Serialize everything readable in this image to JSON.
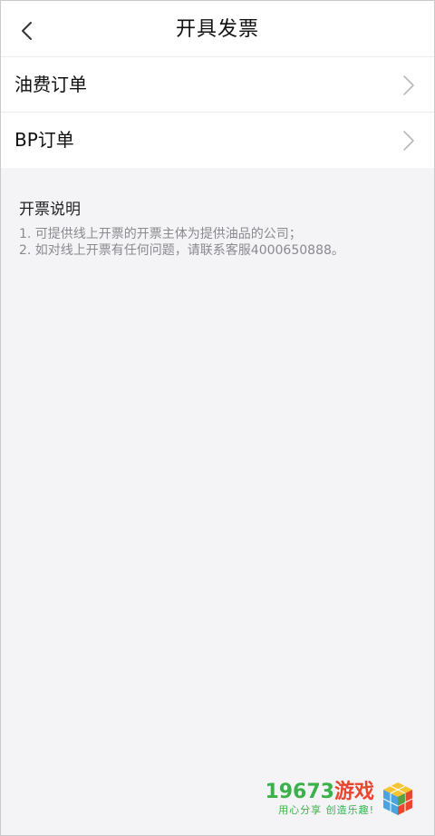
{
  "header": {
    "title": "开具发票"
  },
  "orders": [
    {
      "label": "油费订单"
    },
    {
      "label": "BP订单"
    }
  ],
  "notes": {
    "title": "开票说明",
    "lines": [
      "1. 可提供线上开票的开票主体为提供油品的公司；",
      "2. 如对线上开票有任何问题，请联系客服4000650888。"
    ]
  },
  "watermark": {
    "number": "19673",
    "word": "游戏",
    "slogan": "用心分享  创造乐趣!"
  },
  "icons": {
    "back": "chevron-left-icon",
    "row": "chevron-right-icon",
    "logo": "colored-cubes-icon"
  },
  "colors": {
    "background": "#f4f4f7",
    "card": "#ffffff",
    "note_text": "#8a8a8e",
    "watermark_green": "#3ab14a",
    "watermark_red": "#e8462f"
  }
}
